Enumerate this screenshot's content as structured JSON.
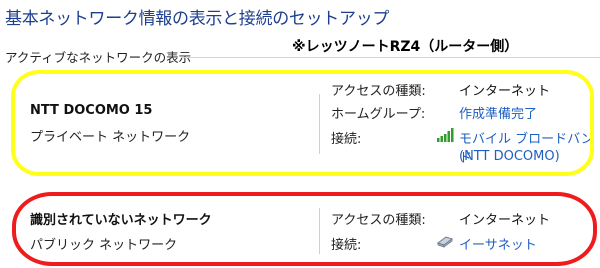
{
  "page": {
    "title": "基本ネットワーク情報の表示と接続のセットアップ",
    "section_header": "アクティブなネットワークの表示",
    "annotation": "※レッツノートRZ4（ルーター側）"
  },
  "networks": [
    {
      "name": "NTT DOCOMO  15",
      "type": "プライベート ネットワーク",
      "highlight_color": "#ffff1a",
      "access_type_label": "アクセスの種類:",
      "access_type_value": "インターネット",
      "homegroup_label": "ホームグループ:",
      "homegroup_value": "作成準備完了",
      "connection_label": "接続:",
      "connection_icon": "mobile-signal-icon",
      "connection_value_line1": "モバイル ブロードバンド",
      "connection_value_line2": "(NTT DOCOMO)"
    },
    {
      "name": "識別されていないネットワーク",
      "type": "パブリック ネットワーク",
      "highlight_color": "#ee1c1c",
      "access_type_label": "アクセスの種類:",
      "access_type_value": "インターネット",
      "connection_label": "接続:",
      "connection_icon": "ethernet-icon",
      "connection_value": "イーサネット"
    }
  ],
  "colors": {
    "title": "#1e3f8f",
    "link": "#1f5fc1"
  }
}
